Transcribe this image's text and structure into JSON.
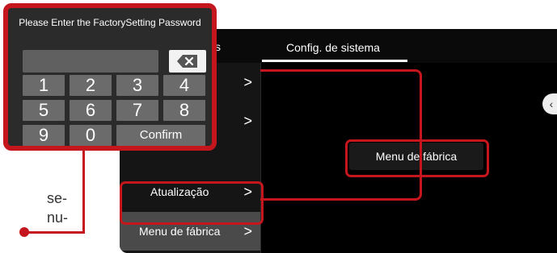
{
  "header": {
    "active_tab": "Config. de sistema"
  },
  "sidebar": {
    "items": [
      {
        "label": "",
        "chevron": ">"
      },
      {
        "label": "",
        "chevron": ">"
      },
      {
        "label": "Atualização",
        "chevron": ">"
      },
      {
        "label": "Menu de fábrica",
        "chevron": ">"
      }
    ]
  },
  "content": {
    "factory_menu_button": "Menu de fábrica"
  },
  "password_dialog": {
    "title": "Please Enter the FactorySetting Password",
    "keys": [
      "1",
      "2",
      "3",
      "4",
      "5",
      "6",
      "7",
      "8",
      "9",
      "0"
    ],
    "confirm_label": "Confirm"
  },
  "side_text": {
    "line1": "se-",
    "line2": "nu-"
  },
  "colors": {
    "accent": "#c4161c",
    "screen_bg": "#000000"
  }
}
